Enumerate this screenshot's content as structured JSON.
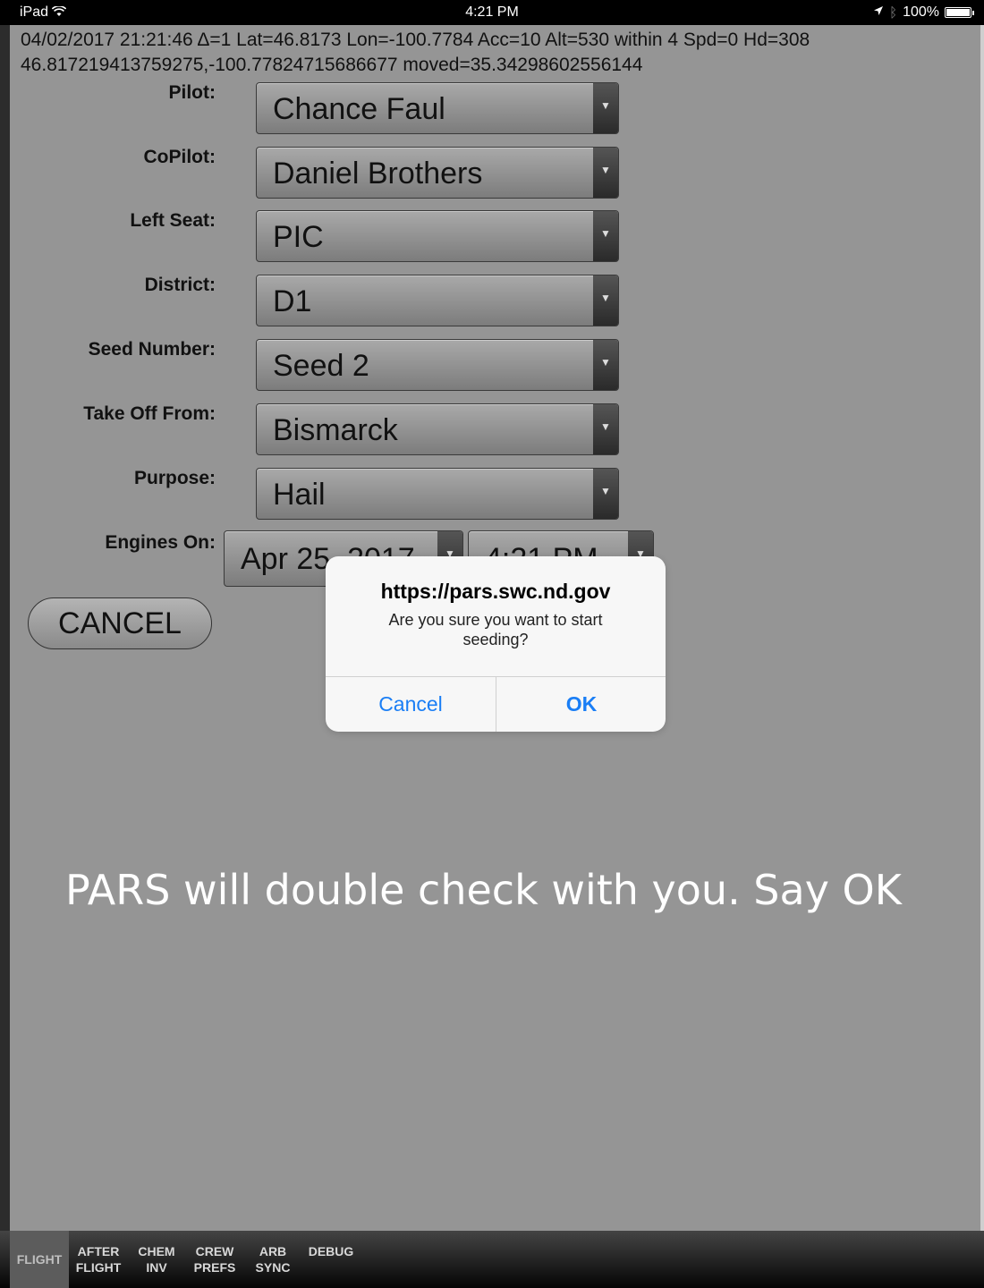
{
  "status_bar": {
    "device": "iPad",
    "time": "4:21 PM",
    "battery": "100%",
    "battery_level": 1.0
  },
  "gps_line1": "04/02/2017 21:21:46 Δ=1 Lat=46.8173 Lon=-100.7784 Acc=10 Alt=530 within 4 Spd=0 Hd=308",
  "gps_line2": "46.817219413759275,-100.77824715686677 moved=35.34298602556144",
  "form": {
    "pilot": {
      "label": "Pilot:",
      "value": "Chance Faul"
    },
    "copilot": {
      "label": "CoPilot:",
      "value": "Daniel Brothers"
    },
    "left_seat": {
      "label": "Left Seat:",
      "value": "PIC"
    },
    "district": {
      "label": "District:",
      "value": "D1"
    },
    "seed_number": {
      "label": "Seed Number:",
      "value": "Seed 2"
    },
    "take_off_from": {
      "label": "Take Off From:",
      "value": "Bismarck"
    },
    "purpose": {
      "label": "Purpose:",
      "value": "Hail"
    },
    "engines_on": {
      "label": "Engines On:",
      "date": "Apr 25, 2017",
      "time": "4:21 PM"
    }
  },
  "cancel_button": "CANCEL",
  "dialog": {
    "title": "https://pars.swc.nd.gov",
    "message": "Are you sure you want to start seeding?",
    "cancel": "Cancel",
    "ok": "OK"
  },
  "caption": "PARS will double check with you. Say OK",
  "tabs": [
    {
      "line1": "FLIGHT",
      "line2": ""
    },
    {
      "line1": "AFTER",
      "line2": "FLIGHT"
    },
    {
      "line1": "CHEM",
      "line2": "INV"
    },
    {
      "line1": "CREW",
      "line2": "PREFS"
    },
    {
      "line1": "ARB",
      "line2": "SYNC"
    },
    {
      "line1": "DEBUG",
      "line2": ""
    }
  ]
}
